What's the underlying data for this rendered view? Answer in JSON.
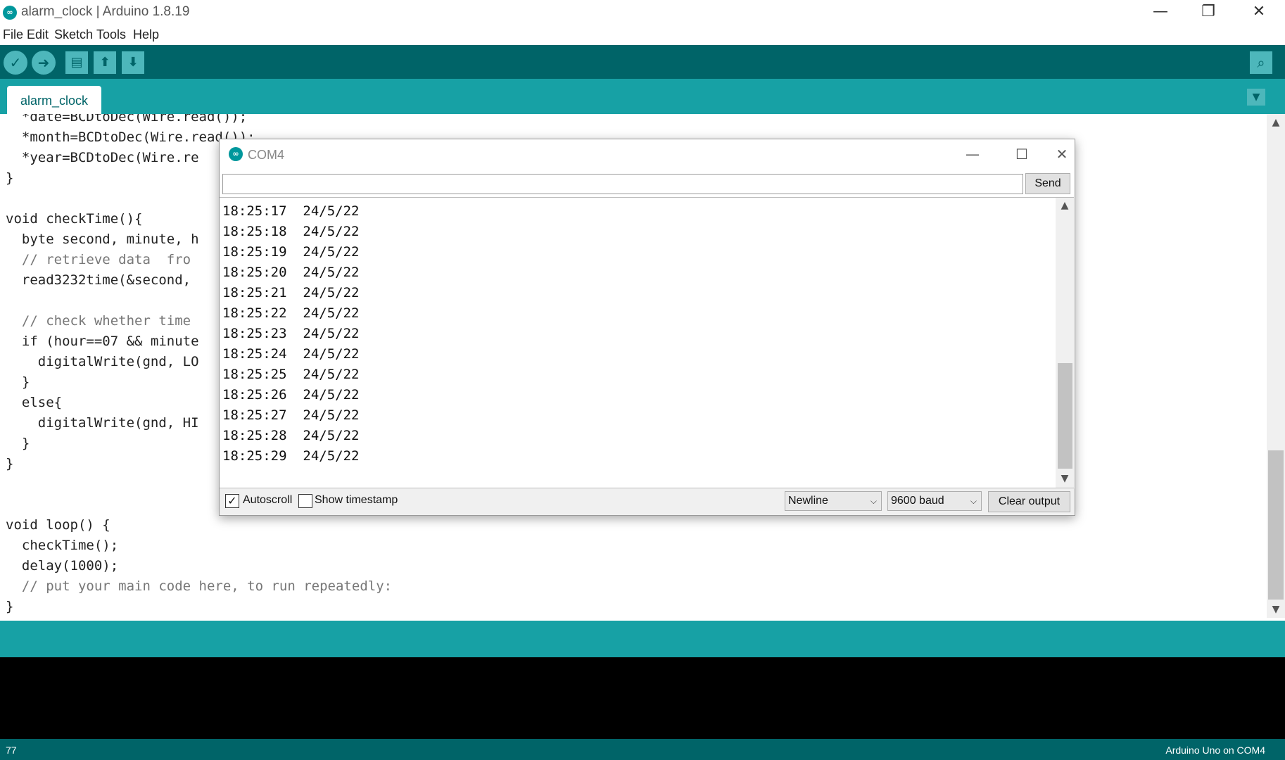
{
  "window": {
    "title": "alarm_clock | Arduino 1.8.19",
    "minimize": "—",
    "restore": "❐",
    "close": "✕"
  },
  "menu": [
    "File",
    "Edit",
    "Sketch",
    "Tools",
    "Help"
  ],
  "toolbar": {
    "verify": "✓",
    "upload": "➜",
    "new": "▤",
    "open": "⬆",
    "save": "⬇",
    "serial_monitor": "⌕"
  },
  "tabs": [
    {
      "label": "alarm_clock"
    }
  ],
  "code_lines": [
    "  *date=BCDtoDec(Wire.read());",
    "  *month=BCDtoDec(Wire.read());",
    "  *year=BCDtoDec(Wire.re",
    "}",
    "",
    "void checkTime(){",
    "  byte second, minute, h",
    "  // retrieve data  fro",
    "  read3232time(&second,",
    "",
    "  // check whether time",
    "  if (hour==07 && minute",
    "    digitalWrite(gnd, LO",
    "  }",
    "  else{",
    "    digitalWrite(gnd, HI",
    "  }",
    "}",
    "",
    "",
    "void loop() {",
    "  checkTime();",
    "  delay(1000);",
    "  // put your main code here, to run repeatedly:",
    "}"
  ],
  "status": {
    "line_number": "77",
    "board": "Arduino Uno on COM4"
  },
  "serial": {
    "title": "COM4",
    "send_label": "Send",
    "input_value": "",
    "output": [
      "18:25:17  24/5/22",
      "18:25:18  24/5/22",
      "18:25:19  24/5/22",
      "18:25:20  24/5/22",
      "18:25:21  24/5/22",
      "18:25:22  24/5/22",
      "18:25:23  24/5/22",
      "18:25:24  24/5/22",
      "18:25:25  24/5/22",
      "18:25:26  24/5/22",
      "18:25:27  24/5/22",
      "18:25:28  24/5/22",
      "18:25:29  24/5/22"
    ],
    "autoscroll_label": "Autoscroll",
    "autoscroll_checked": true,
    "timestamp_label": "Show timestamp",
    "timestamp_checked": false,
    "line_ending": "Newline",
    "baud": "9600 baud",
    "clear_label": "Clear output"
  },
  "colors": {
    "toolbar": "#006468",
    "tabbar": "#17a1a5",
    "keyword": "#00979c",
    "function": "#d35400"
  }
}
